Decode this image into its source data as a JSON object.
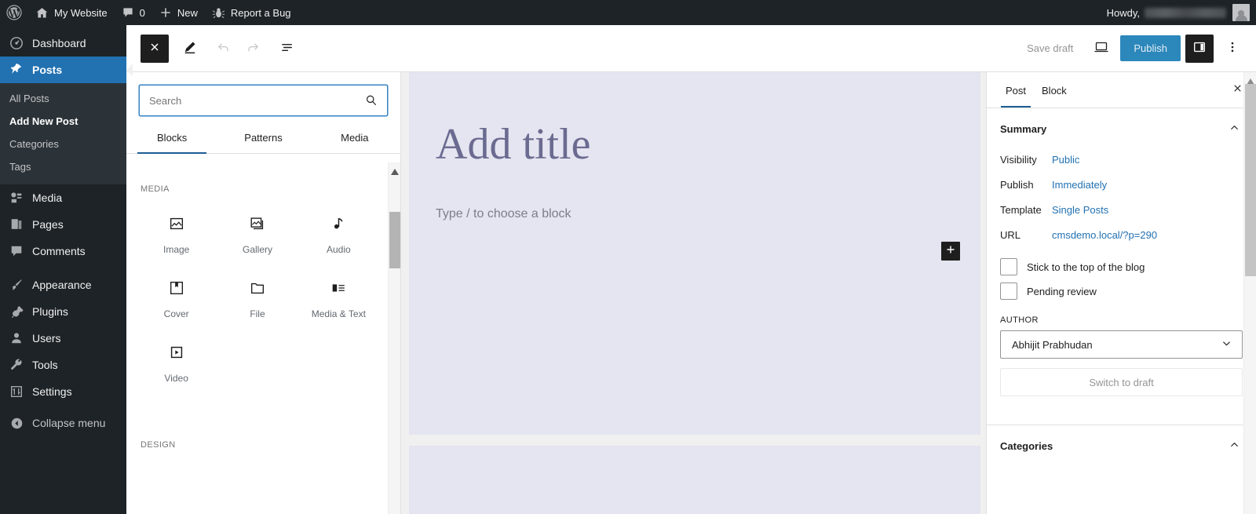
{
  "adminbar": {
    "logo_icon": "wordpress-logo-icon",
    "site_name": "My Website",
    "comments_count": "0",
    "new_label": "New",
    "report_bug_label": "Report a Bug",
    "howdy_label": "Howdy,",
    "user_name_redacted": true
  },
  "adminmenu": {
    "items": [
      {
        "label": "Dashboard",
        "icon": "dashboard-icon",
        "current": false
      },
      {
        "label": "Posts",
        "icon": "pin-icon",
        "current": true
      },
      {
        "label": "Media",
        "icon": "media-icon",
        "current": false
      },
      {
        "label": "Pages",
        "icon": "pages-icon",
        "current": false
      },
      {
        "label": "Comments",
        "icon": "comment-icon",
        "current": false
      },
      {
        "label": "Appearance",
        "icon": "brush-icon",
        "current": false
      },
      {
        "label": "Plugins",
        "icon": "plug-icon",
        "current": false
      },
      {
        "label": "Users",
        "icon": "user-icon",
        "current": false
      },
      {
        "label": "Tools",
        "icon": "wrench-icon",
        "current": false
      },
      {
        "label": "Settings",
        "icon": "sliders-icon",
        "current": false
      }
    ],
    "submenu": [
      {
        "label": "All Posts",
        "current": false
      },
      {
        "label": "Add New Post",
        "current": true
      },
      {
        "label": "Categories",
        "current": false
      },
      {
        "label": "Tags",
        "current": false
      }
    ],
    "collapse_label": "Collapse menu",
    "collapse_icon": "collapse-arrow-icon"
  },
  "editor_header": {
    "close_icon": "close-x-icon",
    "edit_icon": "pencil-edit-icon",
    "undo_icon": "undo-arrow-icon",
    "redo_icon": "redo-arrow-icon",
    "listview_icon": "list-view-icon",
    "save_draft_label": "Save draft",
    "preview_icon": "desktop-preview-icon",
    "publish_label": "Publish",
    "settings_icon": "sidebar-panel-icon",
    "options_icon": "ellipsis-vertical-icon"
  },
  "inserter": {
    "search_placeholder": "Search",
    "search_value": "",
    "search_icon": "search-icon",
    "tabs": [
      {
        "label": "Blocks",
        "active": true
      },
      {
        "label": "Patterns",
        "active": false
      },
      {
        "label": "Media",
        "active": false
      }
    ],
    "sections": [
      {
        "title": "MEDIA",
        "blocks": [
          {
            "label": "Image",
            "icon": "image-icon"
          },
          {
            "label": "Gallery",
            "icon": "gallery-icon"
          },
          {
            "label": "Audio",
            "icon": "audio-note-icon"
          },
          {
            "label": "Cover",
            "icon": "cover-icon"
          },
          {
            "label": "File",
            "icon": "file-folder-icon"
          },
          {
            "label": "Media & Text",
            "icon": "media-text-icon"
          },
          {
            "label": "Video",
            "icon": "video-play-icon"
          }
        ]
      },
      {
        "title": "DESIGN",
        "blocks": []
      }
    ]
  },
  "canvas": {
    "title_placeholder": "Add title",
    "paragraph_placeholder": "Type / to choose a block",
    "add_block_icon": "plus-icon",
    "background_color": "#e4e5f0"
  },
  "settings": {
    "tabs": [
      {
        "label": "Post",
        "active": true
      },
      {
        "label": "Block",
        "active": false
      }
    ],
    "close_icon": "close-x-icon",
    "summary": {
      "title": "Summary",
      "collapse_icon": "chevron-up-icon",
      "rows": [
        {
          "label": "Visibility",
          "value": "Public"
        },
        {
          "label": "Publish",
          "value": "Immediately"
        },
        {
          "label": "Template",
          "value": "Single Posts"
        },
        {
          "label": "URL",
          "value": "cmsdemo.local/?p=290"
        }
      ],
      "checkboxes": [
        {
          "label": "Stick to the top of the blog",
          "checked": false
        },
        {
          "label": "Pending review",
          "checked": false
        }
      ],
      "author_label": "AUTHOR",
      "author_value": "Abhijit Prabhudan",
      "author_chevron_icon": "chevron-down-icon",
      "switch_to_draft_label": "Switch to draft"
    },
    "categories": {
      "title": "Categories",
      "collapse_icon": "chevron-up-icon"
    }
  },
  "colors": {
    "admin_dark": "#1d2327",
    "admin_blue": "#2271b1",
    "publish_blue": "#2c87bb",
    "link_blue": "#2271b1",
    "canvas_bg": "#e4e5f0",
    "title_text": "#6b6b91"
  }
}
